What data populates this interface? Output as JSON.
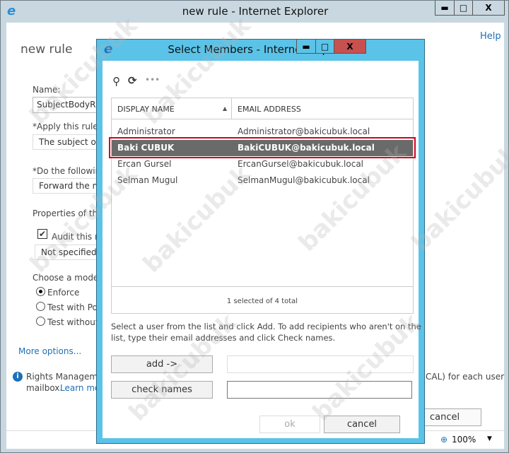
{
  "outer_window": {
    "title": "new rule - Internet Explorer",
    "controls": [
      "minimize",
      "maximize",
      "close"
    ],
    "help_link": "Help",
    "page_title": "new rule",
    "name_label": "Name:",
    "name_value": "SubjectBodyRule",
    "apply_label": "*Apply this rule if",
    "apply_value": "The subject or b",
    "do_label": "*Do the following",
    "do_value": "Forward the me",
    "properties_label": "Properties of this",
    "audit_label": "Audit this ru",
    "audit_checked": true,
    "severity_value": "Not specified",
    "mode_label": "Choose a mode f",
    "modes": [
      {
        "label": "Enforce",
        "selected": true
      },
      {
        "label": "Test with Poli",
        "selected": false
      },
      {
        "label": "Test without",
        "selected": false
      }
    ],
    "more_options": "More options...",
    "info_line1": "Rights Managemen",
    "info_line1_right": "CAL) for each user",
    "info_line2": "mailbox.",
    "learn_more": "Learn mo",
    "cancel_button": "cancel",
    "zoom_level": "100%"
  },
  "dialog": {
    "title": "Select Members - Internet Explorer",
    "toolbar_icons": [
      "search-icon",
      "refresh-icon",
      "more-icon"
    ],
    "columns": [
      "DISPLAY NAME",
      "EMAIL ADDRESS"
    ],
    "sort": "ascending",
    "rows": [
      {
        "name": "Administrator",
        "email": "Administrator@bakicubuk.local",
        "selected": false
      },
      {
        "name": "Baki CUBUK",
        "email": "BakiCUBUK@bakicubuk.local",
        "selected": true
      },
      {
        "name": "Ercan Gursel",
        "email": "ErcanGursel@bakicubuk.local",
        "selected": false
      },
      {
        "name": "Selman Mugul",
        "email": "SelmanMugul@bakicubuk.local",
        "selected": false
      }
    ],
    "status": "1 selected of 4 total",
    "instructions": "Select a user from the list and click Add. To add recipients who aren't on the list, type their email addresses and click Check names.",
    "add_button": "add ->",
    "check_names_button": "check names",
    "ok_button": "ok",
    "cancel_button": "cancel"
  },
  "colors": {
    "dialog_frame": "#5bc3e8",
    "selected_row": "#6a6a6a",
    "highlight_box": "#d0021b",
    "close_button": "#c75050",
    "link": "#1e6fb8"
  },
  "watermark": "bakicubuk"
}
